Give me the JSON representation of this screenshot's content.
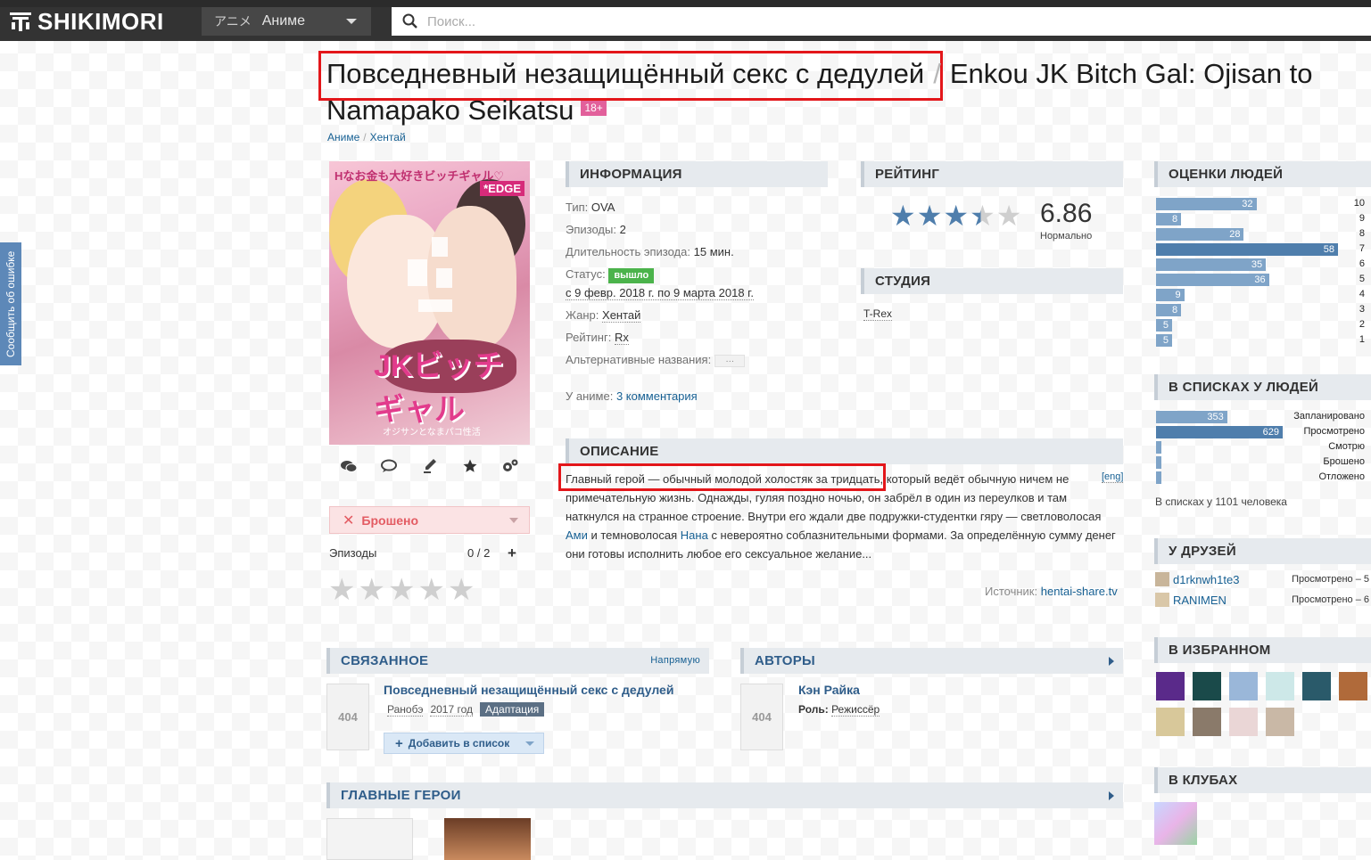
{
  "header": {
    "logo": "SHIKIMORI",
    "menu_jp": "アニメ",
    "menu_label": "Аниме",
    "search_placeholder": "Поиск..."
  },
  "side_tab": "Сообщить об ошибке",
  "title": {
    "ru": "Повседневный незащищённый секс с дедулей",
    "sep": "/",
    "en": "Enkou JK Bitch Gal: Ojisan to Namapako Seikatsu",
    "badge": "18+"
  },
  "breadcrumb": {
    "a": "Аниме",
    "sep": "/",
    "b": "Хентай"
  },
  "poster": {
    "text_top": "Hなお金も大好きビッチギャル♡",
    "edge": "*EDGE",
    "logo": "JKビッチギャル",
    "sub": "オジサンとなまパコ性活"
  },
  "user": {
    "status": "Брошено",
    "episodes_label": "Эпизоды",
    "episodes_value": "0 / 2",
    "plus": "+"
  },
  "sections": {
    "info": "ИНФОРМАЦИЯ",
    "rating": "РЕЙТИНГ",
    "studio": "СТУДИЯ",
    "description": "ОПИСАНИЕ",
    "scores": "ОЦЕНКИ ЛЮДЕЙ",
    "in_lists": "В СПИСКАХ У ЛЮДЕЙ",
    "friends": "У ДРУЗЕЙ",
    "favorites": "В ИЗБРАННОМ",
    "clubs": "В КЛУБАХ",
    "related": "СВЯЗАННОЕ",
    "related_right": "Напрямую",
    "authors": "АВТОРЫ",
    "heroes": "ГЛАВНЫЕ ГЕРОИ"
  },
  "info": {
    "type_k": "Тип:",
    "type_v": "OVA",
    "eps_k": "Эпизоды:",
    "eps_v": "2",
    "dur_k": "Длительность эпизода:",
    "dur_v": "15 мин.",
    "status_k": "Статус:",
    "status_v": "вышло",
    "dates": "с 9 февр. 2018 г. по 9 марта 2018 г.",
    "genre_k": "Жанр:",
    "genre_v": "Хентай",
    "rating_k": "Рейтинг:",
    "rating_v": "Rx",
    "alt_k": "Альтернативные названия:",
    "alt_v": "…",
    "comments_k": "У аниме:",
    "comments_v": "3 комментария"
  },
  "rating": {
    "score": "6.86",
    "label": "Нормально",
    "value_of_10": 6.86
  },
  "studio": "T-Rex",
  "description": {
    "p1": "Главный герой — обычный молодой холостяк за тридцать",
    "p2": ", который ведёт обычную ничем не примечательную жизнь. Однажды, гуляя поздно ночью, он забрёл в один из переулков и там наткнулся на странное строение. Внутри его ждали две подружки-студентки гяру — светловолосая ",
    "ami": "Ами",
    "p3": " и темноволосая ",
    "nana": "Нана",
    "p4": " с невероятно соблазнительными формами. За определённую сумму денег они готовы исполнить любое его сексуальное желание...",
    "eng": "[eng]",
    "source_k": "Источник:",
    "source_v": "hentai-share.tv"
  },
  "scores": [
    {
      "score": "10",
      "count": 32
    },
    {
      "score": "9",
      "count": 8
    },
    {
      "score": "8",
      "count": 28
    },
    {
      "score": "7",
      "count": 58
    },
    {
      "score": "6",
      "count": 35
    },
    {
      "score": "5",
      "count": 36
    },
    {
      "score": "4",
      "count": 9
    },
    {
      "score": "3",
      "count": 8
    },
    {
      "score": "2",
      "count": 5
    },
    {
      "score": "1",
      "count": 5
    }
  ],
  "lists": [
    {
      "label": "Запланировано",
      "count": 353
    },
    {
      "label": "Просмотрено",
      "count": 629
    },
    {
      "label": "Смотрю",
      "count": 4
    },
    {
      "label": "Брошено",
      "count": 11
    },
    {
      "label": "Отложено",
      "count": 8
    }
  ],
  "lists_total": "В списках у 1101 человека",
  "friends": [
    {
      "name": "d1rknwh1te3",
      "status": "Просмотрено – 5"
    },
    {
      "name": "RANIMEN",
      "status": "Просмотрено – 6"
    }
  ],
  "related": {
    "title": "Повседневный незащищённый секс с дедулей",
    "kind": "Ранобэ",
    "year": "2017 год",
    "relation": "Адаптация",
    "add": "Добавить в список",
    "placeholder": "404"
  },
  "author": {
    "name": "Кэн Райка",
    "role_k": "Роль:",
    "role_v": "Режиссёр"
  },
  "colors": {
    "accent": "#176093",
    "highlight": "#e3161a",
    "star": "#4f7eac",
    "dropped": "#e35b62"
  }
}
